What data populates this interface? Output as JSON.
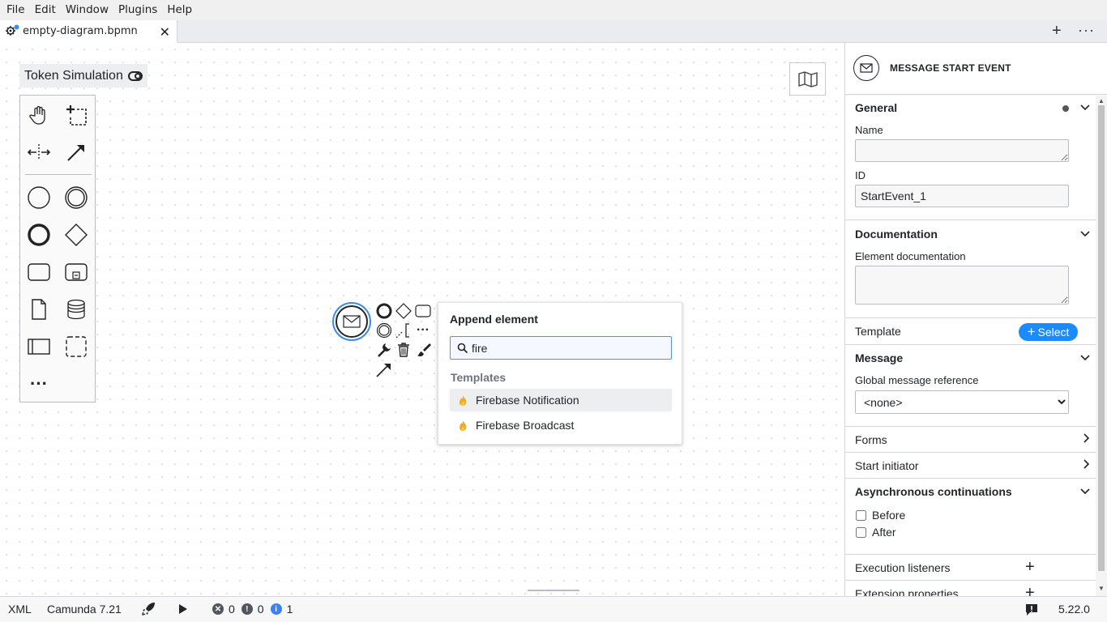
{
  "menu": [
    "File",
    "Edit",
    "Window",
    "Plugins",
    "Help"
  ],
  "tab": {
    "title": "empty-diagram.bpmn",
    "close": "✕"
  },
  "tabbar": {
    "add": "+",
    "more": "···"
  },
  "canvas": {
    "token_simulation": "Token Simulation",
    "palette_more": "···"
  },
  "append_popup": {
    "title": "Append element",
    "search_value": "fire",
    "group_label": "Templates",
    "entries": [
      "Firebase Notification",
      "Firebase Broadcast"
    ]
  },
  "panel": {
    "header_title": "MESSAGE START EVENT",
    "general": {
      "title": "General",
      "name_label": "Name",
      "name_value": "",
      "id_label": "ID",
      "id_value": "StartEvent_1"
    },
    "documentation": {
      "title": "Documentation",
      "label": "Element documentation",
      "value": ""
    },
    "template": {
      "title": "Template",
      "button": "Select"
    },
    "message": {
      "title": "Message",
      "label": "Global message reference",
      "selected": "<none>"
    },
    "forms": {
      "title": "Forms"
    },
    "start_initiator": {
      "title": "Start initiator"
    },
    "async": {
      "title": "Asynchronous continuations",
      "before": "Before",
      "after": "After"
    },
    "execution_listeners": {
      "title": "Execution listeners"
    },
    "extension_properties": {
      "title": "Extension properties"
    }
  },
  "status": {
    "xml": "XML",
    "engine": "Camunda 7.21",
    "errors": "0",
    "warnings": "0",
    "infos": "1",
    "version": "5.22.0"
  },
  "colors": {
    "accent": "#3b8ee8",
    "select_button": "#1a8cff",
    "error": "#52565e",
    "info": "#3b82f6",
    "flame": "#f5a623"
  }
}
